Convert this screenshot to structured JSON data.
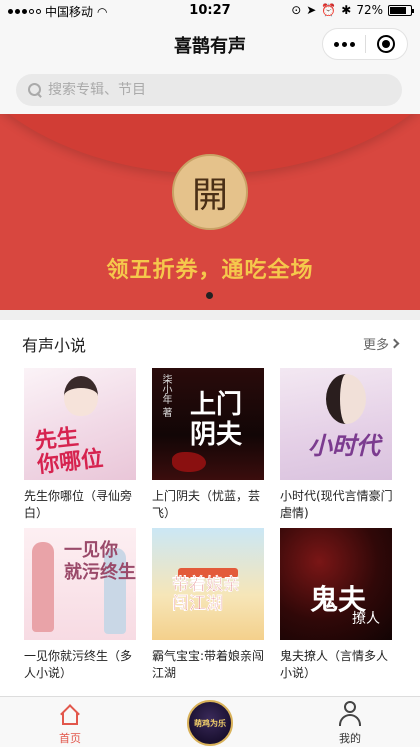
{
  "status_bar": {
    "carrier": "中国移动",
    "time": "10:27",
    "battery": "72%"
  },
  "nav": {
    "title": "喜鹊有声"
  },
  "search": {
    "placeholder": "搜索专辑、节目"
  },
  "banner": {
    "seal_char": "開",
    "slogan": "领五折券，通吃全场",
    "active_slide": 1,
    "slide_count": 1
  },
  "section": {
    "title": "有声小说",
    "more_label": "更多"
  },
  "books": [
    {
      "name": "先生你哪位（寻仙旁白）",
      "cover_title": "先生\n你哪位"
    },
    {
      "name": "上门阴夫（忧蓝，芸飞）",
      "cover_title": "上门\n阴夫",
      "cover_author": "柒小年 著"
    },
    {
      "name": "小时代(现代言情豪门虐情)",
      "cover_title": "小时代"
    },
    {
      "name": "一见你就污终生（多人小说）",
      "cover_title": "一见你\n就污终生"
    },
    {
      "name": "霸气宝宝:带着娘亲闯江湖",
      "cover_title": "带着娘亲\n闯江湖"
    },
    {
      "name": "鬼夫撩人（言情多人小说）",
      "cover_title": "鬼夫",
      "cover_subtitle": "撩人"
    }
  ],
  "tabbar": {
    "home_label": "首页",
    "center_label": "萌鸡为乐",
    "me_label": "我的"
  },
  "colors": {
    "accent": "#e2574c",
    "banner": "#d8473f",
    "slogan": "#f5c84c"
  }
}
